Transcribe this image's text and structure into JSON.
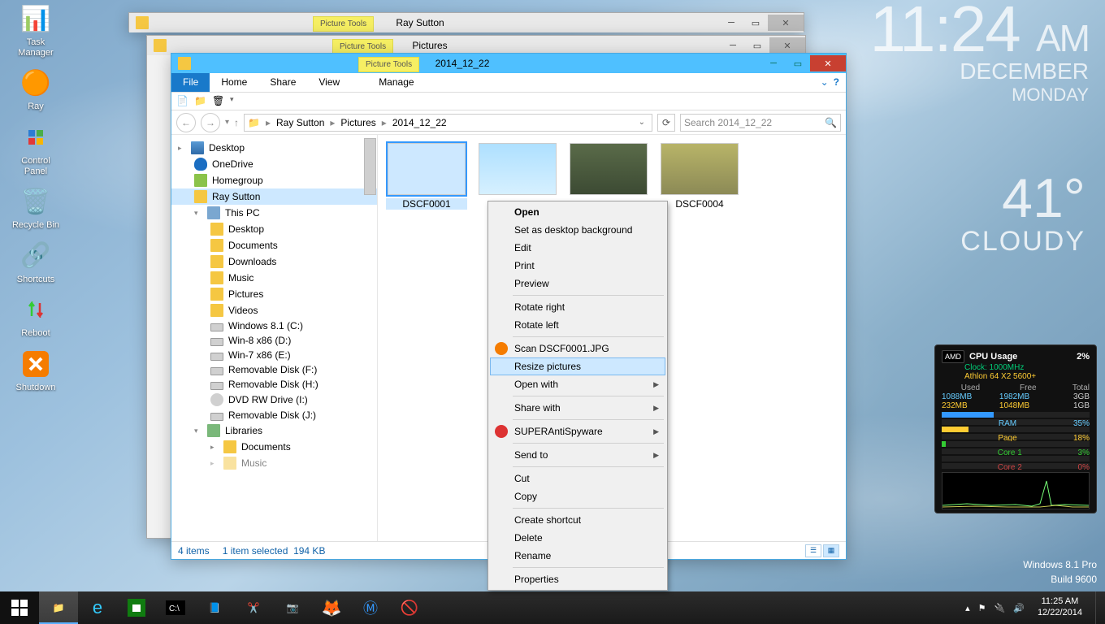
{
  "desktop_icons": [
    {
      "name": "task-manager",
      "label": "Task\nManager"
    },
    {
      "name": "ray",
      "label": "Ray"
    },
    {
      "name": "control-panel",
      "label": "Control\nPanel"
    },
    {
      "name": "recycle-bin",
      "label": "Recycle Bin"
    },
    {
      "name": "shortcuts",
      "label": "Shortcuts"
    },
    {
      "name": "reboot",
      "label": "Reboot"
    },
    {
      "name": "shutdown",
      "label": "Shutdown"
    }
  ],
  "clock": {
    "time": "11:24",
    "ampm": "AM",
    "month": "DECEMBER",
    "day": "MONDAY"
  },
  "weather": {
    "temp": "41°",
    "cond": "CLOUDY"
  },
  "watermark": {
    "line1": "Windows 8.1 Pro",
    "line2": "Build 9600"
  },
  "cpu": {
    "title": "CPU Usage",
    "pct": "2%",
    "clock": "Clock: 1000MHz",
    "model": "Athlon 64 X2 5600+",
    "hdr_used": "Used",
    "hdr_free": "Free",
    "hdr_total": "Total",
    "row1_used": "1088MB",
    "row1_free": "1982MB",
    "row1_total": "3GB",
    "row2_used": "232MB",
    "row2_free": "1048MB",
    "row2_total": "1GB",
    "bar_ram_label": "RAM",
    "bar_ram_pct": "35%",
    "bar_page_label": "Page",
    "bar_page_pct": "18%",
    "bar_c1_label": "Core 1",
    "bar_c1_pct": "3%",
    "bar_c2_label": "Core 2",
    "bar_c2_pct": "0%"
  },
  "bgwin1": {
    "title": "Ray Sutton",
    "tools": "Picture Tools"
  },
  "bgwin2": {
    "title": "Pictures",
    "tools": "Picture Tools"
  },
  "explorer": {
    "title": "2014_12_22",
    "tools": "Picture Tools",
    "tabs": {
      "file": "File",
      "home": "Home",
      "share": "Share",
      "view": "View",
      "manage": "Manage"
    },
    "breadcrumb": [
      "Ray Sutton",
      "Pictures",
      "2014_12_22"
    ],
    "search_placeholder": "Search 2014_12_22",
    "nav": {
      "desktop": "Desktop",
      "onedrive": "OneDrive",
      "homegroup": "Homegroup",
      "raysutton": "Ray Sutton",
      "thispc": "This PC",
      "pc_desktop": "Desktop",
      "documents": "Documents",
      "downloads": "Downloads",
      "music": "Music",
      "pictures": "Pictures",
      "videos": "Videos",
      "win81": "Windows 8.1 (C:)",
      "win8x86": "Win-8 x86 (D:)",
      "win7x86": "Win-7 x86 (E:)",
      "remF": "Removable Disk (F:)",
      "remH": "Removable Disk (H:)",
      "dvd": "DVD RW Drive (I:)",
      "remJ": "Removable Disk (J:)",
      "libraries": "Libraries",
      "lib_docs": "Documents",
      "lib_music": "Music"
    },
    "thumbs": {
      "t1": "DSCF0001",
      "t4": "DSCF0004"
    },
    "status": {
      "count": "4 items",
      "sel": "1 item selected",
      "size": "194 KB"
    }
  },
  "context_menu": {
    "open": "Open",
    "setbg": "Set as desktop background",
    "edit": "Edit",
    "print": "Print",
    "preview": "Preview",
    "rot_r": "Rotate right",
    "rot_l": "Rotate left",
    "scan": "Scan DSCF0001.JPG",
    "resize": "Resize pictures",
    "openwith": "Open with",
    "sharewith": "Share with",
    "sas": "SUPERAntiSpyware",
    "sendto": "Send to",
    "cut": "Cut",
    "copy": "Copy",
    "shortcut": "Create shortcut",
    "delete": "Delete",
    "rename": "Rename",
    "props": "Properties"
  },
  "tray": {
    "time": "11:25 AM",
    "date": "12/22/2014"
  }
}
